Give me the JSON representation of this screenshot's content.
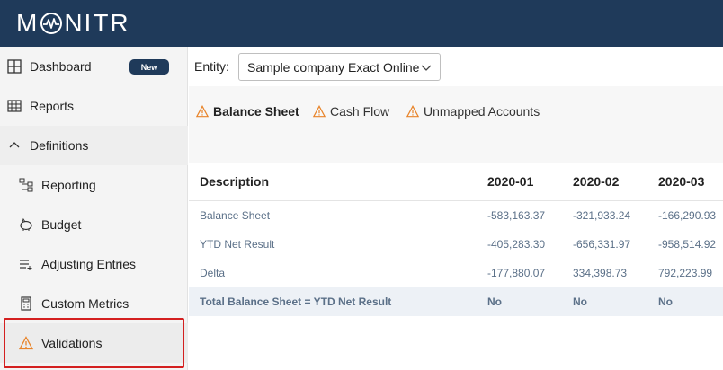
{
  "app": {
    "logo_text": [
      "M",
      "NITR"
    ]
  },
  "sidebar": {
    "items": [
      {
        "label": "Dashboard",
        "badge": "New",
        "icon": "dashboard-grid-icon"
      },
      {
        "label": "Reports",
        "icon": "table-icon"
      },
      {
        "label": "Definitions",
        "icon": "chevron-up-icon"
      },
      {
        "label": "Reporting",
        "icon": "hierarchy-icon"
      },
      {
        "label": "Budget",
        "icon": "piggy-bank-icon"
      },
      {
        "label": "Adjusting Entries",
        "icon": "list-plus-icon"
      },
      {
        "label": "Custom Metrics",
        "icon": "calculator-icon"
      },
      {
        "label": "Validations",
        "icon": "warning-icon"
      }
    ]
  },
  "entity": {
    "label": "Entity:",
    "selected": "Sample company Exact Online"
  },
  "tabs": [
    {
      "label": "Balance Sheet",
      "active": true
    },
    {
      "label": "Cash Flow",
      "active": false
    },
    {
      "label": "Unmapped Accounts",
      "active": false
    }
  ],
  "table": {
    "headers": [
      "Description",
      "2020-01",
      "2020-02",
      "2020-03"
    ],
    "rows": [
      {
        "desc": "Balance Sheet",
        "v1": "-583,163.37",
        "v2": "-321,933.24",
        "v3": "-166,290.93"
      },
      {
        "desc": "YTD Net Result",
        "v1": "-405,283.30",
        "v2": "-656,331.97",
        "v3": "-958,514.92"
      },
      {
        "desc": "Delta",
        "v1": "-177,880.07",
        "v2": "334,398.73",
        "v3": "792,223.99"
      },
      {
        "desc": "Total Balance Sheet = YTD Net Result",
        "v1": "No",
        "v2": "No",
        "v3": "No"
      }
    ]
  },
  "colors": {
    "brand": "#1f3a5a",
    "warning": "#e8842a",
    "tab_underline": "#f2c200",
    "highlight": "#d42020"
  }
}
